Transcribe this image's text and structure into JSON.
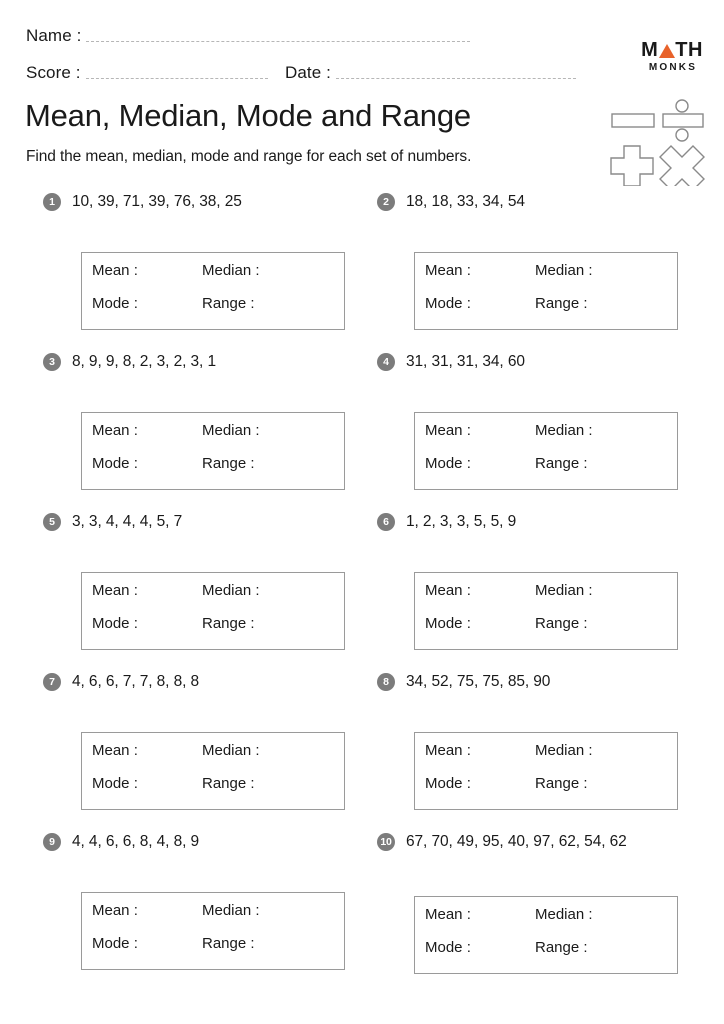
{
  "header": {
    "name_label": "Name :",
    "score_label": "Score :",
    "date_label": "Date :",
    "title": "Mean, Median, Mode and Range",
    "subtitle": "Find the mean, median, mode and range for each set of numbers.",
    "logo": {
      "brand_part1": "M",
      "brand_part2": "TH",
      "brand_sub": "MONKS",
      "triangle_color": "#e8622a"
    },
    "operator_icons": [
      "minus-icon",
      "divide-icon",
      "plus-icon",
      "multiply-icon"
    ]
  },
  "answer_labels": {
    "mean": "Mean :",
    "median": "Median :",
    "mode": "Mode :",
    "range": "Range :"
  },
  "problems": [
    {
      "number": "1",
      "numbers": "10, 39, 71, 39, 76, 38, 25"
    },
    {
      "number": "2",
      "numbers": "18, 18, 33, 34, 54"
    },
    {
      "number": "3",
      "numbers": "8, 9, 9, 8, 2, 3, 2, 3, 1"
    },
    {
      "number": "4",
      "numbers": "31, 31, 31, 34, 60"
    },
    {
      "number": "5",
      "numbers": "3, 3, 4, 4, 4, 5, 7"
    },
    {
      "number": "6",
      "numbers": "1, 2, 3, 3, 5, 5, 9"
    },
    {
      "number": "7",
      "numbers": "4, 6, 6, 7, 7, 8, 8, 8"
    },
    {
      "number": "8",
      "numbers": "34, 52, 75, 75, 85, 90"
    },
    {
      "number": "9",
      "numbers": "4, 4, 6, 6, 8, 4, 8, 9"
    },
    {
      "number": "10",
      "numbers": "67, 70, 49, 95, 40, 97, 62, 54, 62"
    }
  ]
}
